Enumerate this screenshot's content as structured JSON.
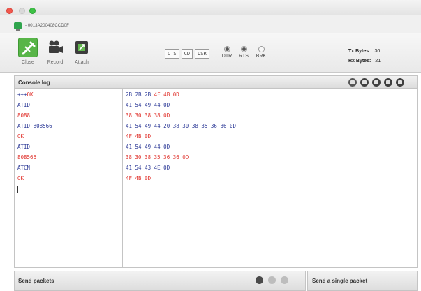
{
  "window": {
    "device_label": "- 0013A200408CCD0F"
  },
  "toolbar": {
    "close_label": "Close",
    "record_label": "Record",
    "attach_label": "Attach",
    "lines": [
      "CTS",
      "CD",
      "DSR"
    ],
    "toggles": [
      {
        "label": "DTR",
        "state": "on"
      },
      {
        "label": "RTS",
        "state": "on"
      },
      {
        "label": "BRK",
        "state": "off"
      }
    ],
    "tx_label": "Tx Bytes:",
    "tx_value": "30",
    "rx_label": "Rx Bytes:",
    "rx_value": "21"
  },
  "console": {
    "title": "Console log",
    "controls": [
      "disconnect-icon",
      "refresh-icon",
      "stop-icon",
      "lock-icon",
      "close-icon"
    ],
    "ascii_rows": [
      {
        "text": "+++OK",
        "kind": "mixed"
      },
      {
        "text": "ATID",
        "kind": "tx"
      },
      {
        "text": "8088",
        "kind": "rx"
      },
      {
        "text": "ATID 808566",
        "kind": "tx"
      },
      {
        "text": "OK",
        "kind": "rx"
      },
      {
        "text": "ATID",
        "kind": "tx"
      },
      {
        "text": "808566",
        "kind": "rx"
      },
      {
        "text": "ATCN",
        "kind": "tx"
      },
      {
        "text": "OK",
        "kind": "rx"
      }
    ],
    "hex_rows": [
      {
        "text": "2B 2B 2B 4F 4B 0D",
        "kind": "mixed"
      },
      {
        "text": "41 54 49 44 0D",
        "kind": "tx"
      },
      {
        "text": "38 30 38 38 0D",
        "kind": "rx"
      },
      {
        "text": "41 54 49 44 20 38 30 38 35 36 36 0D",
        "kind": "tx"
      },
      {
        "text": "4F 4B 0D",
        "kind": "rx"
      },
      {
        "text": "41 54 49 44 0D",
        "kind": "tx"
      },
      {
        "text": "38 30 38 35 36 36 0D",
        "kind": "rx"
      },
      {
        "text": "41 54 43 4E 0D",
        "kind": "tx"
      },
      {
        "text": "4F 4B 0D",
        "kind": "rx"
      }
    ],
    "colors": {
      "tx": "#2f3c98",
      "rx": "#e0322c"
    }
  },
  "send_packets": {
    "title": "Send packets"
  },
  "single_packet": {
    "title": "Send a single packet"
  }
}
